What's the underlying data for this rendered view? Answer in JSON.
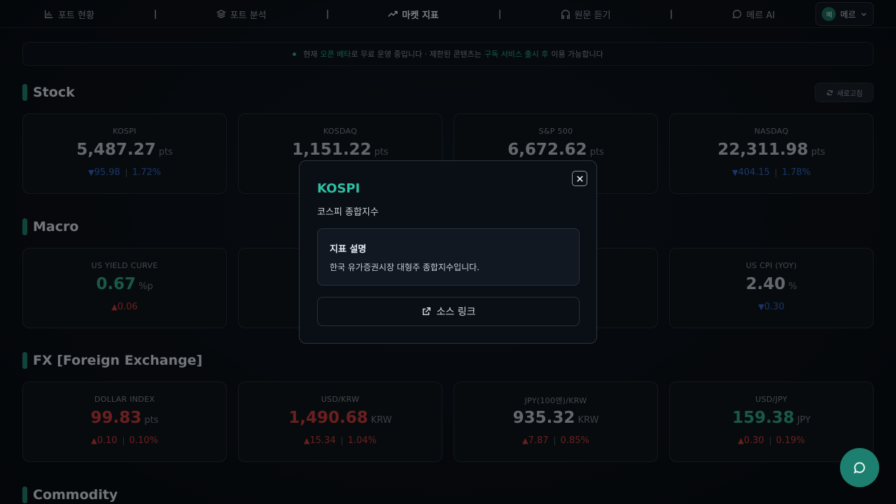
{
  "nav": {
    "items": [
      {
        "label": "포트 현황",
        "icon": "bar-chart-icon"
      },
      {
        "label": "포트 분석",
        "icon": "layers-icon"
      },
      {
        "label": "마켓 지표",
        "icon": "trending-up-icon"
      },
      {
        "label": "원문 듣기",
        "icon": "headphones-icon"
      },
      {
        "label": "메르 AI",
        "icon": "chat-bubble-icon"
      }
    ],
    "active_index": 2,
    "user": {
      "avatar": "메",
      "name": "메르"
    }
  },
  "banner": {
    "part1": "현재",
    "highlight1": "오픈 베타",
    "part2": "로 무료 운영 중입니다 · 제한된 콘텐츠는",
    "highlight2": "구독 서비스 출시 후",
    "part3": "이용 가능합니다"
  },
  "sections": {
    "stock": "Stock",
    "macro": "Macro",
    "fx": "FX [Foreign Exchange]",
    "commodity": "Commodity"
  },
  "refresh_label": "새로고침",
  "stock": [
    {
      "label": "KOSPI",
      "value": "5,487.27",
      "unit": "pts",
      "change": "95.98",
      "pct": "1.72%",
      "dir": "down"
    },
    {
      "label": "KOSDAQ",
      "value": "1,151.22",
      "unit": "pts",
      "change": "",
      "pct": "",
      "dir": "down"
    },
    {
      "label": "S&P 500",
      "value": "6,672.62",
      "unit": "pts",
      "change": "",
      "pct": "",
      "dir": "down"
    },
    {
      "label": "NASDAQ",
      "value": "22,311.98",
      "unit": "pts",
      "change": "404.15",
      "pct": "1.78%",
      "dir": "down"
    }
  ],
  "macro": [
    {
      "label": "US YIELD CURVE",
      "value": "0.67",
      "unit": "%p",
      "change": "0.06",
      "dir": "up"
    },
    {
      "label": "US CPI (YOY)",
      "value": "2.40",
      "unit": "%",
      "change": "0.30",
      "dir": "down"
    }
  ],
  "fx": [
    {
      "label": "DOLLAR INDEX",
      "value": "99.83",
      "unit": "pts",
      "change": "0.10",
      "pct": "0.10%",
      "dir": "up"
    },
    {
      "label": "USD/KRW",
      "value": "1,490.68",
      "unit": "KRW",
      "change": "15.34",
      "pct": "1.04%",
      "dir": "up"
    },
    {
      "label": "JPY(100엔)/KRW",
      "value": "935.32",
      "unit": "KRW",
      "change": "7.87",
      "pct": "0.85%",
      "dir": "up"
    },
    {
      "label": "USD/JPY",
      "value": "159.38",
      "unit": "JPY",
      "change": "0.30",
      "pct": "0.19%",
      "dir": "up"
    }
  ],
  "modal": {
    "title": "KOSPI",
    "subtitle": "코스피 종합지수",
    "desc_heading": "지표 설명",
    "desc_text": "한국 유가증권시장 대형주 종합지수입니다.",
    "link_label": "소스 링크"
  },
  "colors": {
    "accent": "#2aa58f",
    "up": "#c23a3a",
    "down": "#2e63c4",
    "green": "#2fa37e"
  }
}
